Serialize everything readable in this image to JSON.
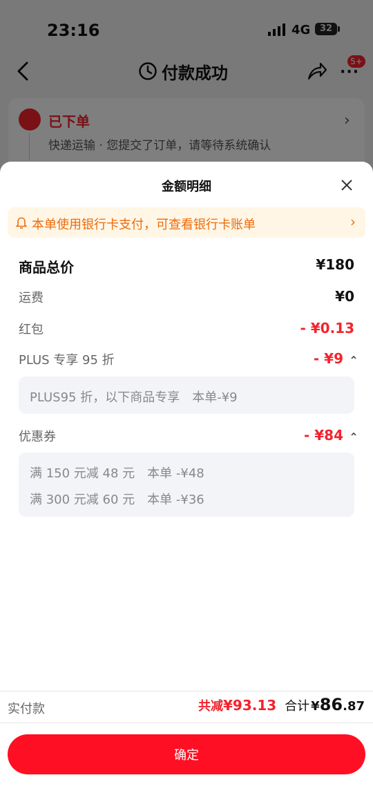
{
  "status_bar": {
    "time": "23:16",
    "network": "4G",
    "battery": "32"
  },
  "nav": {
    "title": "付款成功",
    "badge": "5+"
  },
  "order": {
    "title": "已下单",
    "subtitle": "快递运输 · 您提交了订单，请等待系统确认"
  },
  "sheet": {
    "title": "金额明细",
    "notice": "本单使用银行卡支付，可查看银行卡账单",
    "rows": [
      {
        "label": "商品总价",
        "value": "¥180"
      },
      {
        "label": "运费",
        "value": "¥0"
      },
      {
        "label": "红包",
        "value": "- ¥0.13"
      },
      {
        "label": "PLUS 专享 95 折",
        "value": "- ¥9"
      },
      {
        "label": "优惠券",
        "value": "- ¥84"
      }
    ],
    "plus_detail": "PLUS95 折，以下商品专享　本单-¥9",
    "coupon_details": [
      "满 150 元减 48 元　本单 -¥48",
      "满 300 元减 60 元　本单 -¥36"
    ]
  },
  "footer": {
    "paid_label": "实付款",
    "reduced_label": "共减",
    "reduced_value": "¥93.13",
    "total_label": "合计",
    "total_yen": "¥",
    "total_int": "86",
    "total_dec": ".87",
    "confirm_label": "确定"
  },
  "colors": {
    "accent": "#f3232d",
    "notice_text": "#ef6b0a",
    "notice_bg": "#fff6e6",
    "button": "#ff0f23"
  }
}
